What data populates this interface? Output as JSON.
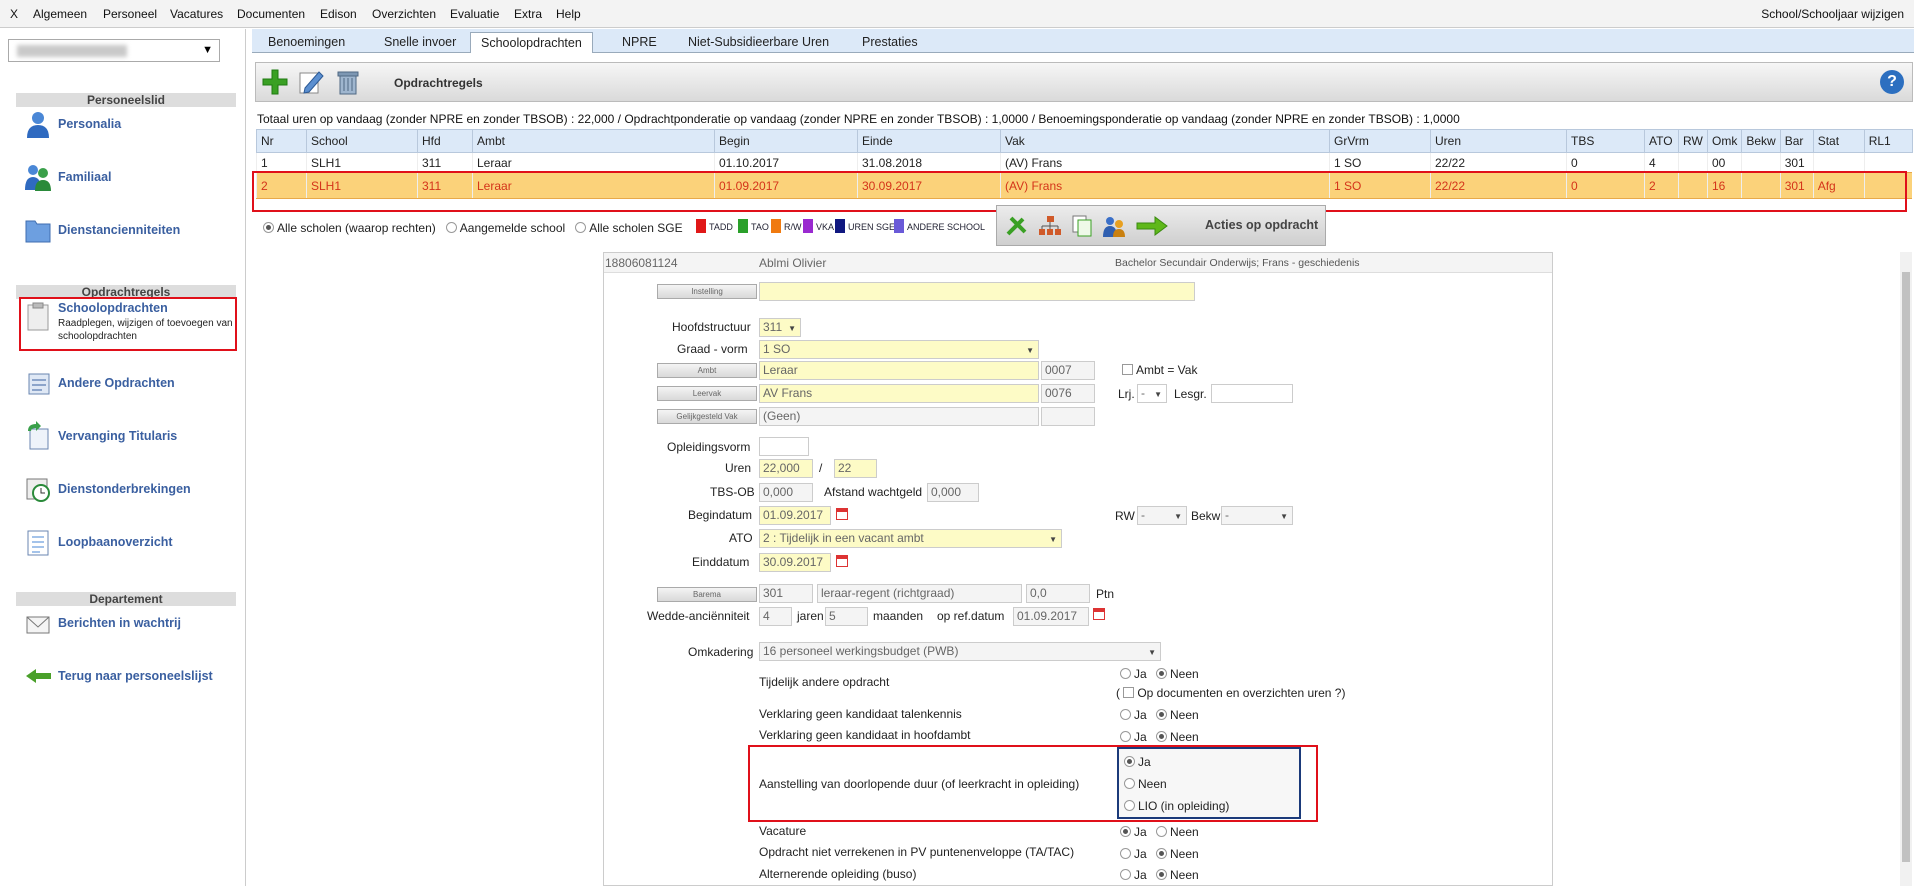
{
  "menubar": {
    "items": [
      "X",
      "Algemeen",
      "Personeel",
      "Vacatures",
      "Documenten",
      "Edison",
      "Overzichten",
      "Evaluatie",
      "Extra",
      "Help"
    ],
    "right": "School/Schooljaar wijzigen"
  },
  "sidebar": {
    "sections": [
      "Personeelslid",
      "Opdrachtregels",
      "Departement"
    ],
    "items": [
      {
        "label": "Personalia",
        "icon": "person-icon"
      },
      {
        "label": "Familiaal",
        "icon": "family-icon"
      },
      {
        "label": "Dienstancienniteiten",
        "icon": "folder-icon"
      },
      {
        "label": "Schoolopdrachten",
        "sub": "Raadplegen, wijzigen of toevoegen van schoolopdrachten",
        "icon": "clipboard-icon"
      },
      {
        "label": "Andere Opdrachten",
        "icon": "tasks-icon"
      },
      {
        "label": "Vervanging Titularis",
        "icon": "replace-icon"
      },
      {
        "label": "Dienstonderbrekingen",
        "icon": "calendar-clock-icon"
      },
      {
        "label": "Loopbaanoverzicht",
        "icon": "list-icon"
      },
      {
        "label": "Berichten in wachtrij",
        "icon": "envelope-icon"
      },
      {
        "label": "Terug naar personeelslijst",
        "icon": "back-arrow-icon"
      }
    ]
  },
  "tabs": [
    "Benoemingen",
    "Snelle invoer",
    "Schoolopdrachten",
    "NPRE",
    "Niet-Subsidieerbare Uren",
    "Prestaties"
  ],
  "toolbar": {
    "title": "Opdrachtregels",
    "help": "?"
  },
  "totals": "Totaal uren op vandaag (zonder NPRE en zonder TBSOB) : 22,000 / Opdrachtponderatie op vandaag (zonder NPRE en zonder TBSOB) : 1,0000 / Benoemingsponderatie op vandaag (zonder NPRE en zonder TBSOB) : 1,0000",
  "table": {
    "headers": [
      "Nr",
      "School",
      "Hfd",
      "Ambt",
      "Begin",
      "Einde",
      "Vak",
      "GrVrm",
      "Uren",
      "TBS",
      "ATO",
      "RW",
      "Omk",
      "Bekw",
      "Bar",
      "Stat",
      "RL1"
    ],
    "rows": [
      [
        "1",
        "SLH1",
        "311",
        "Leraar",
        "01.10.2017",
        "31.08.2018",
        "(AV) Frans",
        "1 SO",
        "22/22",
        "0",
        "4",
        "",
        "00",
        "",
        "301",
        "",
        ""
      ],
      [
        "2",
        "SLH1",
        "311",
        "Leraar",
        "01.09.2017",
        "30.09.2017",
        "(AV) Frans",
        "1 SO",
        "22/22",
        "0",
        "2",
        "",
        "16",
        "",
        "301",
        "Afg",
        ""
      ]
    ]
  },
  "filter": {
    "options": [
      "Alle scholen (waarop rechten)",
      "Aangemelde school",
      "Alle scholen SGE"
    ],
    "legend": [
      {
        "label": "TADD",
        "color": "#e01818"
      },
      {
        "label": "TAO",
        "color": "#2aa02a"
      },
      {
        "label": "R/W",
        "color": "#f07a10"
      },
      {
        "label": "VKA",
        "color": "#9a2ad0"
      },
      {
        "label": "UREN SGE",
        "color": "#101880"
      },
      {
        "label": "ANDERE SCHOOL",
        "color": "#6a5ad8"
      }
    ]
  },
  "actions": {
    "label": "Acties op opdracht"
  },
  "form": {
    "id": "18806081124",
    "name": "Ablmi Olivier",
    "diploma": "Bachelor Secundair Onderwijs; Frans - geschiedenis",
    "btn_instelling": "Instelling",
    "lbl_hoofdstructuur": "Hoofdstructuur",
    "val_hoofdstructuur": "311",
    "lbl_graad": "Graad - vorm",
    "val_graad": "1 SO",
    "btn_ambt": "Ambt",
    "val_ambt": "Leraar",
    "code_ambt": "0007",
    "lbl_ambt_vak": "Ambt = Vak",
    "btn_leervak": "Leervak",
    "val_leervak": "AV Frans",
    "code_leervak": "0076",
    "lbl_lrj": "Lrj.",
    "val_lrj": "-",
    "lbl_lesgr": "Lesgr.",
    "btn_gelijk": "Gelijkgesteld Vak",
    "val_gelijk": "(Geen)",
    "lbl_opleidingsvorm": "Opleidingsvorm",
    "lbl_uren": "Uren",
    "val_uren1": "22,000",
    "uren_sep": "/",
    "val_uren2": "22",
    "lbl_tbsob": "TBS-OB",
    "val_tbsob": "0,000",
    "lbl_afstand": "Afstand wachtgeld",
    "val_afstand": "0,000",
    "lbl_begindatum": "Begindatum",
    "val_begindatum": "01.09.2017",
    "lbl_rw": "RW",
    "val_rw": "-",
    "lbl_bekw": "Bekw",
    "val_bekw": "-",
    "lbl_ato": "ATO",
    "val_ato": "2 : Tijdelijk in een vacant ambt",
    "lbl_einddatum": "Einddatum",
    "val_einddatum": "30.09.2017",
    "btn_barema": "Barema",
    "val_barema": "301",
    "val_barema_desc": "leraar-regent (richtgraad)",
    "val_ptn": "0,0",
    "lbl_ptn": "Ptn",
    "lbl_wedde": "Wedde-anciënniteit",
    "val_jaren": "4",
    "lbl_jaren": "jaren",
    "val_maanden": "5",
    "lbl_maanden": "maanden",
    "lbl_refdatum": "op ref.datum",
    "val_refdatum": "01.09.2017",
    "lbl_omkadering": "Omkadering",
    "val_omkadering": "16 personeel werkingsbudget (PWB)",
    "opt_ja": "Ja",
    "opt_neen": "Neen",
    "opt_lio": "LIO (in opleiding)",
    "lbl_tijdelijk": "Tijdelijk andere opdracht",
    "paren": "(",
    "lbl_opdoc": "Op documenten en overzichten uren ?)",
    "lbl_talenkennis": "Verklaring geen kandidaat talenkennis",
    "lbl_hoofdambt": "Verklaring geen kandidaat in hoofdambt",
    "lbl_aanstelling": "Aanstelling van doorlopende duur (of leerkracht in opleiding)",
    "lbl_vacature": "Vacature",
    "lbl_pv": "Opdracht niet verrekenen in PV puntenenveloppe (TA/TAC)",
    "lbl_alternerende": "Alternerende opleiding (buso)"
  }
}
